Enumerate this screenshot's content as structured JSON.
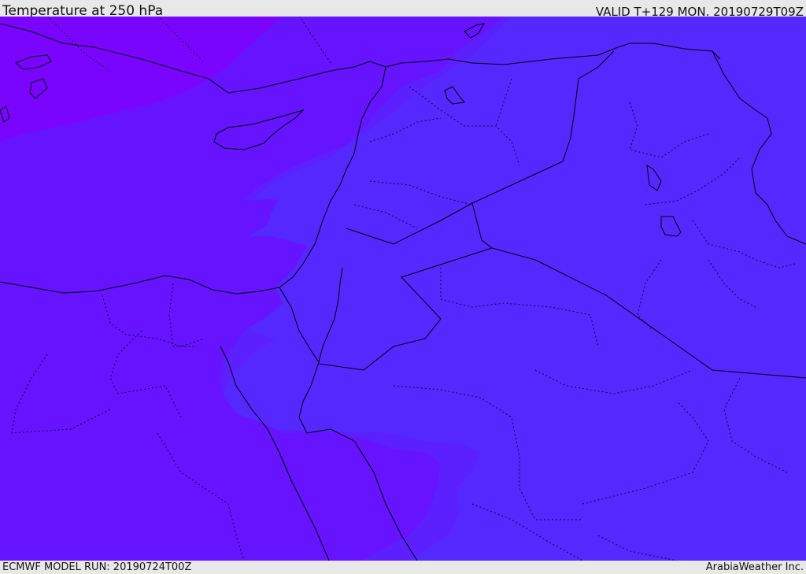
{
  "header": {
    "title": "Temperature at 250 hPa",
    "valid": "VALID T+129 MON. 20190729T09Z"
  },
  "footer": {
    "model_run": "ECMWF MODEL RUN: 20190724T00Z",
    "credit": "ArabiaWeather Inc."
  },
  "colors": {
    "coldest": "#7a05ff",
    "cold": "#6614ff",
    "mid": "#5c20ff",
    "warm": "#5428ff",
    "boundary": "#000000"
  }
}
